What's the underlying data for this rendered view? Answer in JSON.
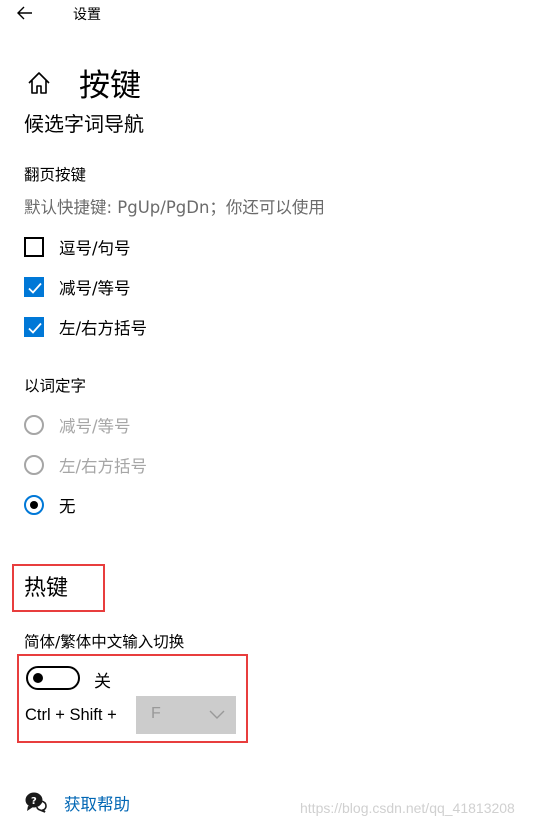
{
  "titlebar": {
    "title": "设置",
    "back_icon": "back-arrow-icon"
  },
  "header": {
    "home_icon": "home-icon",
    "title": "按键"
  },
  "candidate_nav": {
    "section_title": "候选字词导航",
    "paging": {
      "label": "翻页按键",
      "hint": "默认快捷键: PgUp/PgDn；你还可以使用",
      "options": [
        {
          "label": "逗号/句号",
          "checked": false
        },
        {
          "label": "减号/等号",
          "checked": true
        },
        {
          "label": "左/右方括号",
          "checked": true
        }
      ]
    },
    "word_select": {
      "label": "以词定字",
      "options": [
        {
          "label": "减号/等号",
          "disabled": true,
          "selected": false
        },
        {
          "label": "左/右方括号",
          "disabled": true,
          "selected": false
        },
        {
          "label": "无",
          "disabled": false,
          "selected": true
        }
      ]
    }
  },
  "hotkeys": {
    "section_title": "热键",
    "switch_label": "简体/繁体中文输入切换",
    "toggle_on": false,
    "toggle_state": "关",
    "combo_prefix": "Ctrl + Shift +",
    "combo_key": "F"
  },
  "help": {
    "icon": "help-chat-icon",
    "label": "获取帮助"
  },
  "watermark": "https://blog.csdn.net/qq_41813208",
  "colors": {
    "accent": "#0078d7",
    "highlight_box": "#e83d3d",
    "link": "#0066b4",
    "disabled": "#a6a6a6"
  }
}
